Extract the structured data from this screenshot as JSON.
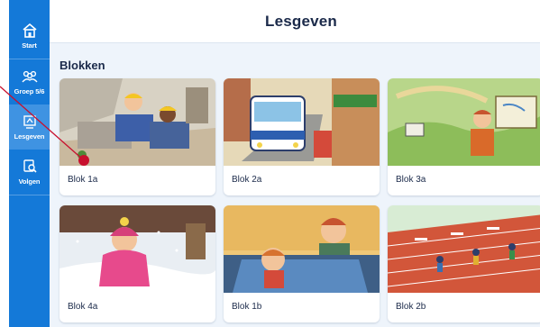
{
  "app": {
    "header_title": "Lesgeven"
  },
  "sidebar": {
    "items": [
      {
        "label": "Start",
        "icon": "home-icon",
        "active": false
      },
      {
        "label": "Groep 5/6",
        "icon": "group-icon",
        "active": false
      },
      {
        "label": "Lesgeven",
        "icon": "teach-icon",
        "active": true
      },
      {
        "label": "Volgen",
        "icon": "track-icon",
        "active": false
      }
    ]
  },
  "main": {
    "section_title": "Blokken",
    "cards": [
      {
        "label": "Blok 1a",
        "illustration": "construction-workers-illustration"
      },
      {
        "label": "Blok 2a",
        "illustration": "tram-street-illustration"
      },
      {
        "label": "Blok 3a",
        "illustration": "map-reading-illustration"
      },
      {
        "label": "Blok 4a",
        "illustration": "snow-child-illustration"
      },
      {
        "label": "Blok 1b",
        "illustration": "boy-in-car-illustration"
      },
      {
        "label": "Blok 2b",
        "illustration": "hurdles-race-illustration"
      }
    ]
  },
  "colors": {
    "sidebar": "#1479d8",
    "sidebar_active": "#3f93e2",
    "background": "#eef4fb",
    "text": "#1b2a4a",
    "pointer": "#c8102e"
  }
}
